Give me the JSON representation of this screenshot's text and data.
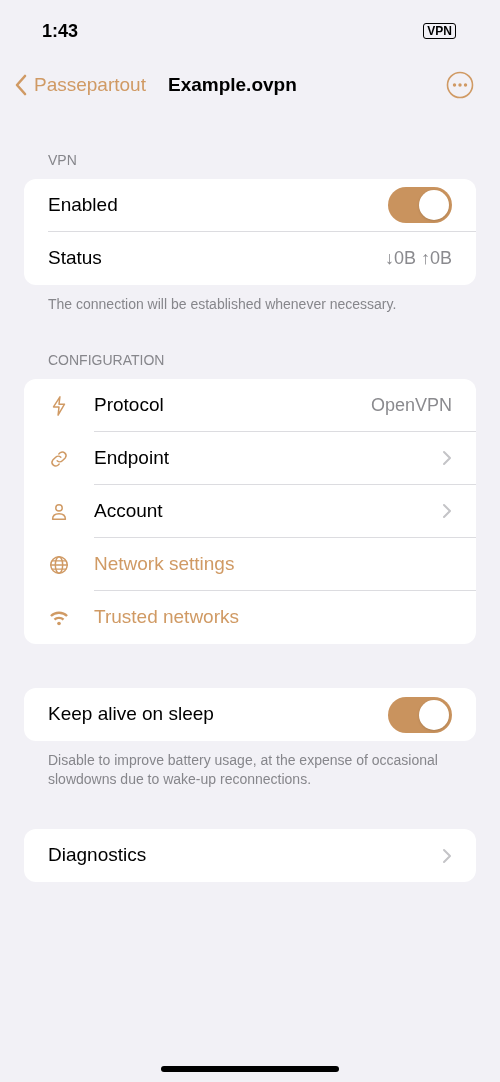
{
  "status_bar": {
    "time": "1:43",
    "vpn_badge": "VPN"
  },
  "nav": {
    "back": "Passepartout",
    "title": "Example.ovpn"
  },
  "vpn_section": {
    "header": "VPN",
    "rows": [
      {
        "kind": "toggle",
        "label": "Enabled",
        "on": true
      },
      {
        "kind": "value",
        "label": "Status",
        "value": "↓0B ↑0B"
      }
    ],
    "footer": "The connection will be established whenever necessary."
  },
  "configuration_section": {
    "header": "CONFIGURATION",
    "rows": [
      {
        "kind": "value",
        "label": "Protocol",
        "value": "OpenVPN"
      },
      {
        "kind": "disclosure",
        "label": "Endpoint"
      },
      {
        "kind": "disclosure",
        "label": "Account"
      },
      {
        "kind": "action",
        "label": "Network settings"
      },
      {
        "kind": "action",
        "label": "Trusted networks"
      }
    ]
  },
  "sleep_section": {
    "rows": [
      {
        "kind": "toggle",
        "label": "Keep alive on sleep",
        "on": true
      }
    ],
    "footer": "Disable to improve battery usage, at the expense of occasional slowdowns due to wake-up reconnections."
  },
  "diagnostics_section": {
    "rows": [
      {
        "kind": "disclosure",
        "label": "Diagnostics"
      }
    ]
  }
}
